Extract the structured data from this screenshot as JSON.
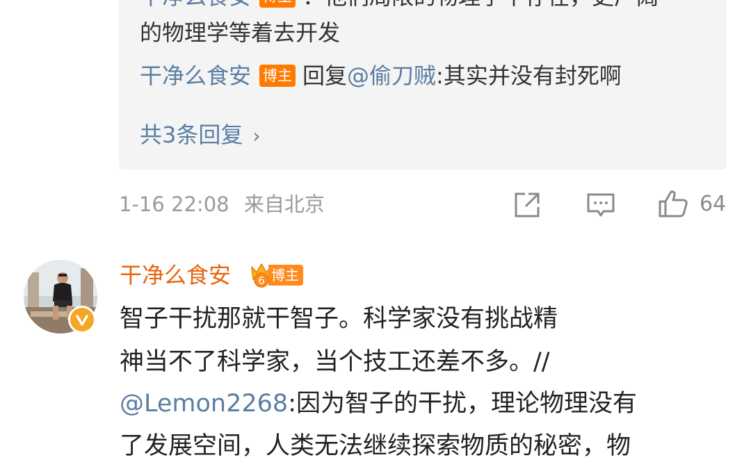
{
  "replies": [
    {
      "author": "干净么食安",
      "badge": "博主",
      "text_line1": "：他们局限的物理学不存在，更广阔",
      "text_line2": "的物理学等着去开发"
    },
    {
      "author": "干净么食安",
      "badge": "博主",
      "reply_prefix": "回复",
      "mention": "@偷刀贼",
      "text": ":其实并没有封死啊"
    }
  ],
  "more_replies": {
    "label": "共3条回复",
    "chevron": "›",
    "icon": "chevron-right-icon"
  },
  "comment_meta": {
    "time": "1-16 22:08",
    "source": "来自北京",
    "like_count": "64",
    "icons": [
      "share-icon",
      "comment-icon",
      "thumbs-up-icon"
    ]
  },
  "comment": {
    "author": "干净么食安",
    "badge": "博主",
    "line1": "智子干扰那就干智子。科学家没有挑战精",
    "line2": "神当不了科学家，当个技工还差不多。//",
    "line3_mention": "@Lemon2268",
    "line3_text": ":因为智子的干扰，理论物理没有",
    "line4": "了发展空间，人类无法继续探索物质的秘密，物"
  },
  "colors": {
    "link_blue": "#5a7ea3",
    "author_orange": "#e8650d",
    "badge_orange": "#ff7a00",
    "verified_gold": "#f5a623",
    "reply_bg": "#f4f4f4"
  }
}
